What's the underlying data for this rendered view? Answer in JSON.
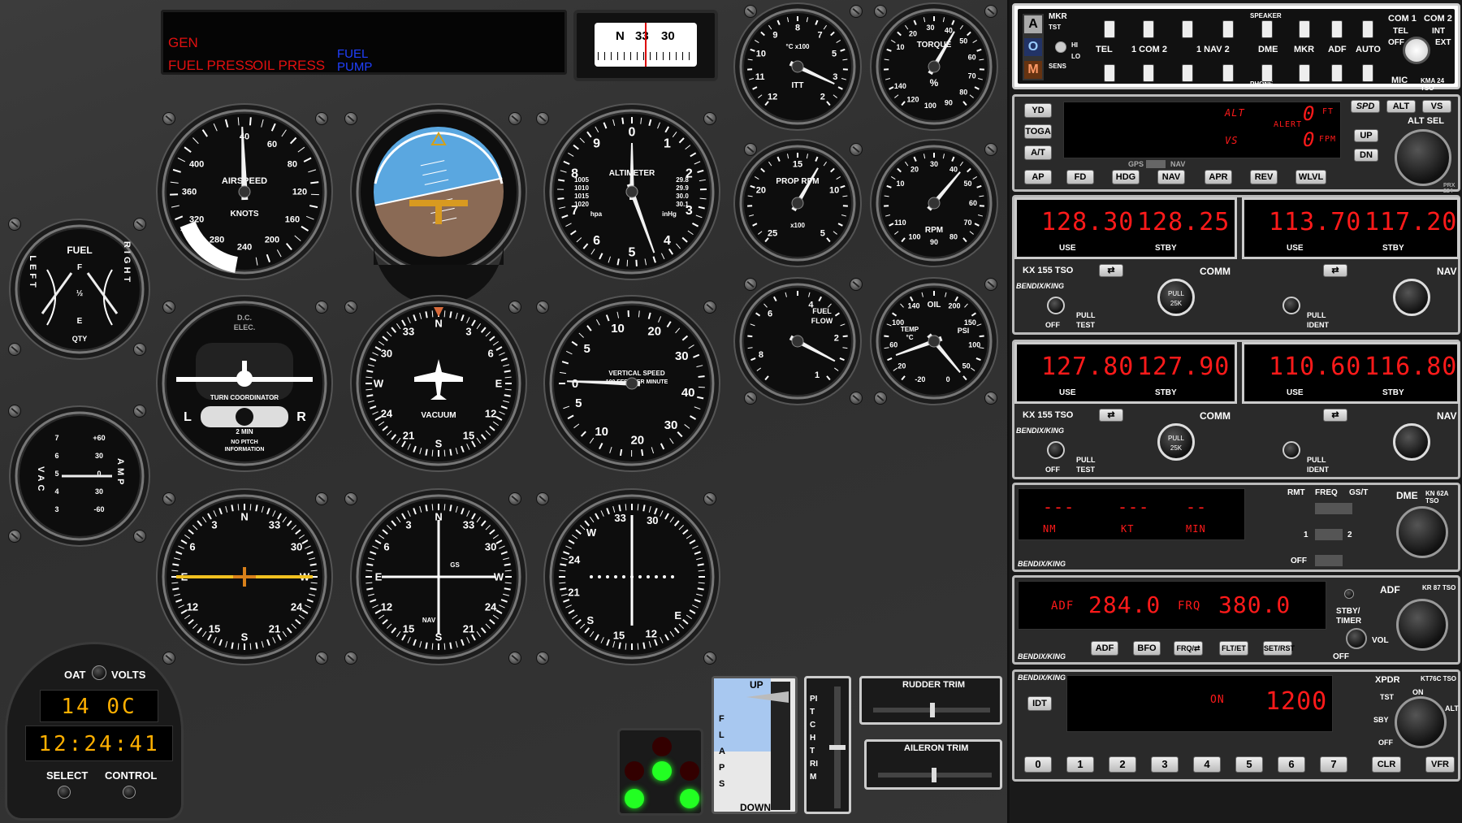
{
  "annunciator": {
    "gen": "GEN",
    "fuel_press": "FUEL PRESS",
    "oil_press": "OIL PRESS",
    "fuel_pump_1": "FUEL",
    "fuel_pump_2": "PUMP"
  },
  "compass": {
    "n": "N",
    "n33": "33",
    "n30": "30"
  },
  "airspeed": {
    "title": "AIRSPEED",
    "unit": "KNOTS",
    "ticks": [
      "40",
      "60",
      "80",
      "120",
      "160",
      "200",
      "240",
      "280",
      "320",
      "360",
      "400"
    ],
    "bug_ticks": [
      "320",
      "280",
      "240"
    ]
  },
  "attitude": {},
  "altimeter": {
    "title": "ALTIMETER",
    "nums": [
      "0",
      "1",
      "2",
      "3",
      "4",
      "5",
      "6",
      "7",
      "8",
      "9"
    ],
    "baro1": "1005",
    "baro2": "1010",
    "baro3": "1015",
    "baro4": "1020",
    "inhg1": "29.8",
    "inhg2": "29.9",
    "inhg3": "30.0",
    "inhg4": "30.1",
    "hpa": "hpa",
    "inhg": "inHg"
  },
  "itt": {
    "title": "ITT",
    "unit": "°C x100",
    "ticks": [
      "2",
      "3",
      "5",
      "7",
      "8",
      "9",
      "10",
      "11",
      "12"
    ]
  },
  "torque": {
    "title": "TORQUE",
    "unit": "%",
    "ticks": [
      "10",
      "20",
      "30",
      "40",
      "50",
      "60",
      "70",
      "80",
      "90",
      "100",
      "120",
      "140"
    ]
  },
  "prop_rpm": {
    "title": "PROP RPM",
    "unit": "x100",
    "ticks": [
      "5",
      "10",
      "15",
      "20",
      "25"
    ]
  },
  "rpm": {
    "title": "RPM",
    "ticks": [
      "10",
      "20",
      "30",
      "40",
      "50",
      "60",
      "70",
      "80",
      "90",
      "100",
      "110"
    ]
  },
  "fuel_flow": {
    "title1": "FUEL",
    "title2": "FLOW",
    "ticks": [
      "1",
      "2",
      "4",
      "6",
      "8"
    ]
  },
  "oil": {
    "title": "OIL",
    "temp": "TEMP",
    "tempunit": "°C",
    "psi": "PSI",
    "ticks_t": [
      "140",
      "100",
      "60",
      "20",
      "-20"
    ],
    "ticks_p": [
      "200",
      "150",
      "100",
      "50",
      "0"
    ]
  },
  "fuel_qty": {
    "title": "FUEL",
    "left": "LEFT",
    "right": "RIGHT",
    "f": "F",
    "half": "½",
    "e": "E",
    "qty": "QTY"
  },
  "vac_amp": {
    "vac": "VAC",
    "amp": "AMP",
    "ticks_l": [
      "7",
      "6",
      "5",
      "4",
      "3"
    ],
    "ticks_r": [
      "+60",
      "30",
      "0",
      "30",
      "-60"
    ]
  },
  "turn_coord": {
    "dc": "D.C.",
    "elec": "ELEC.",
    "title": "TURN COORDINATOR",
    "l": "L",
    "r": "R",
    "min": "2 MIN",
    "note1": "NO PITCH",
    "note2": "INFORMATION"
  },
  "heading": {
    "title": "VACUUM",
    "card": [
      "33",
      "30",
      "W",
      "24",
      "21",
      "S",
      "15",
      "12",
      "E",
      "6",
      "3",
      "N"
    ]
  },
  "vsi": {
    "title1": "VERTICAL SPEED",
    "title2": "100 FEET PER MINUTE",
    "ticks": [
      "0",
      "5",
      "10",
      "20",
      "30",
      "40",
      "30",
      "20",
      "10",
      "5"
    ]
  },
  "hsi_adf": {
    "card": [
      "N",
      "33",
      "30",
      "W",
      "24",
      "21",
      "S",
      "15",
      "12",
      "E",
      "6",
      "3"
    ]
  },
  "vor1": {
    "gs": "GS",
    "nav": "NAV",
    "card": [
      "N",
      "33",
      "30",
      "W",
      "24",
      "21",
      "S",
      "15",
      "12",
      "E",
      "6",
      "3"
    ]
  },
  "vor2": {
    "card": [
      "30",
      "33",
      "W",
      "24",
      "21",
      "S",
      "15",
      "12",
      "E"
    ]
  },
  "clock": {
    "oat": "OAT",
    "volts": "VOLTS",
    "temp": "14 0C",
    "time": "12:24:41",
    "select": "SELECT",
    "control": "CONTROL"
  },
  "marker": {
    "rows": [
      {
        "on": false
      },
      {
        "on": true
      },
      {
        "on": false
      }
    ]
  },
  "flaps": {
    "up": "UP",
    "down": "DOWN",
    "label": "FLAPS"
  },
  "pitch_trim": {
    "label": "PITCH TRIM"
  },
  "rudder_trim": {
    "label": "RUDDER TRIM"
  },
  "aileron_trim": {
    "label": "AILERON TRIM"
  },
  "audio_panel": {
    "speaker": "SPEAKER",
    "phone": "PHONE",
    "mic": "MIC",
    "model": "KMA 24 TSO",
    "a": "A",
    "o": "O",
    "m": "M",
    "mkr": "MKR",
    "tst": "TST",
    "sens": "SENS",
    "hi": "HI",
    "lo": "LO",
    "tel": "TEL",
    "com12": "1 COM 2",
    "nav12": "1 NAV 2",
    "dme": "DME",
    "mkr2": "MKR",
    "adf": "ADF",
    "auto": "AUTO",
    "com1": "COM 1",
    "com2": "COM 2",
    "tel2": "TEL",
    "int": "INT",
    "off": "OFF",
    "ext": "EXT"
  },
  "autopilot": {
    "yd": "YD",
    "toga": "TOGA",
    "at": "A/T",
    "ap": "AP",
    "fd": "FD",
    "hdg": "HDG",
    "nav": "NAV",
    "apr": "APR",
    "rev": "REV",
    "wlvl": "WLVL",
    "alt": "ALT",
    "alt_val": "0",
    "ft": "FT",
    "alert": "ALERT",
    "vs": "VS",
    "vs_val": "0",
    "fpm": "FPM",
    "gps": "GPS",
    "nav2": "NAV",
    "spd": "SPD",
    "alt2": "ALT",
    "vs2": "VS",
    "altsel": "ALT SEL",
    "up": "UP",
    "dn": "DN",
    "model": "PRX 224"
  },
  "comm1": {
    "use": "128.30",
    "stby": "128.25",
    "use_l": "USE",
    "stby_l": "STBY",
    "model": "KX 155 TSO",
    "comm": "COMM",
    "brand": "BENDIX/KING",
    "off": "OFF",
    "pull": "PULL",
    "test": "TEST",
    "pull25": "PULL",
    "k25": "25K"
  },
  "nav1": {
    "use": "113.70",
    "stby": "117.20",
    "use_l": "USE",
    "stby_l": "STBY",
    "nav": "NAV",
    "pull": "PULL",
    "ident": "IDENT"
  },
  "comm2": {
    "use": "127.80",
    "stby": "127.90",
    "use_l": "USE",
    "stby_l": "STBY",
    "model": "KX 155 TSO",
    "comm": "COMM",
    "brand": "BENDIX/KING",
    "off": "OFF",
    "pull": "PULL",
    "test": "TEST",
    "pull25": "PULL",
    "k25": "25K"
  },
  "nav2": {
    "use": "110.60",
    "stby": "116.80",
    "use_l": "USE",
    "stby_l": "STBY",
    "nav": "NAV",
    "pull": "PULL",
    "ident": "IDENT"
  },
  "dme": {
    "nm_val": "---",
    "kt_val": "---",
    "min_val": "--",
    "nm": "NM",
    "kt": "KT",
    "min": "MIN",
    "rmt": "RMT",
    "freq": "FREQ",
    "gsT": "GS/T",
    "title": "DME",
    "model": "KN 62A TSO",
    "one": "1",
    "two": "2",
    "off": "OFF",
    "brand": "BENDIX/KING"
  },
  "adf": {
    "adf_l": "ADF",
    "adf_val": "284.0",
    "frq_l": "FRQ",
    "frq_val": "380.0",
    "title": "ADF",
    "model": "KR 87 TSO",
    "stby": "STBY/",
    "timer": "TIMER",
    "vol": "VOL",
    "off": "OFF",
    "brand": "BENDIX/KING",
    "b_adf": "ADF",
    "b_bfo": "BFO",
    "b_frq": "FRQ/⇄",
    "b_flt": "FLT/ET",
    "b_set": "SET/RST"
  },
  "xpdr": {
    "brand": "BENDIX/KING",
    "idt": "IDT",
    "on": "ON",
    "code": "1200",
    "title": "XPDR",
    "model": "KT76C TSO",
    "tst": "TST",
    "on2": "ON",
    "sby": "SBY",
    "alt": "ALT",
    "off": "OFF",
    "keys": [
      "0",
      "1",
      "2",
      "3",
      "4",
      "5",
      "6",
      "7"
    ],
    "clr": "CLR",
    "vfr": "VFR"
  }
}
